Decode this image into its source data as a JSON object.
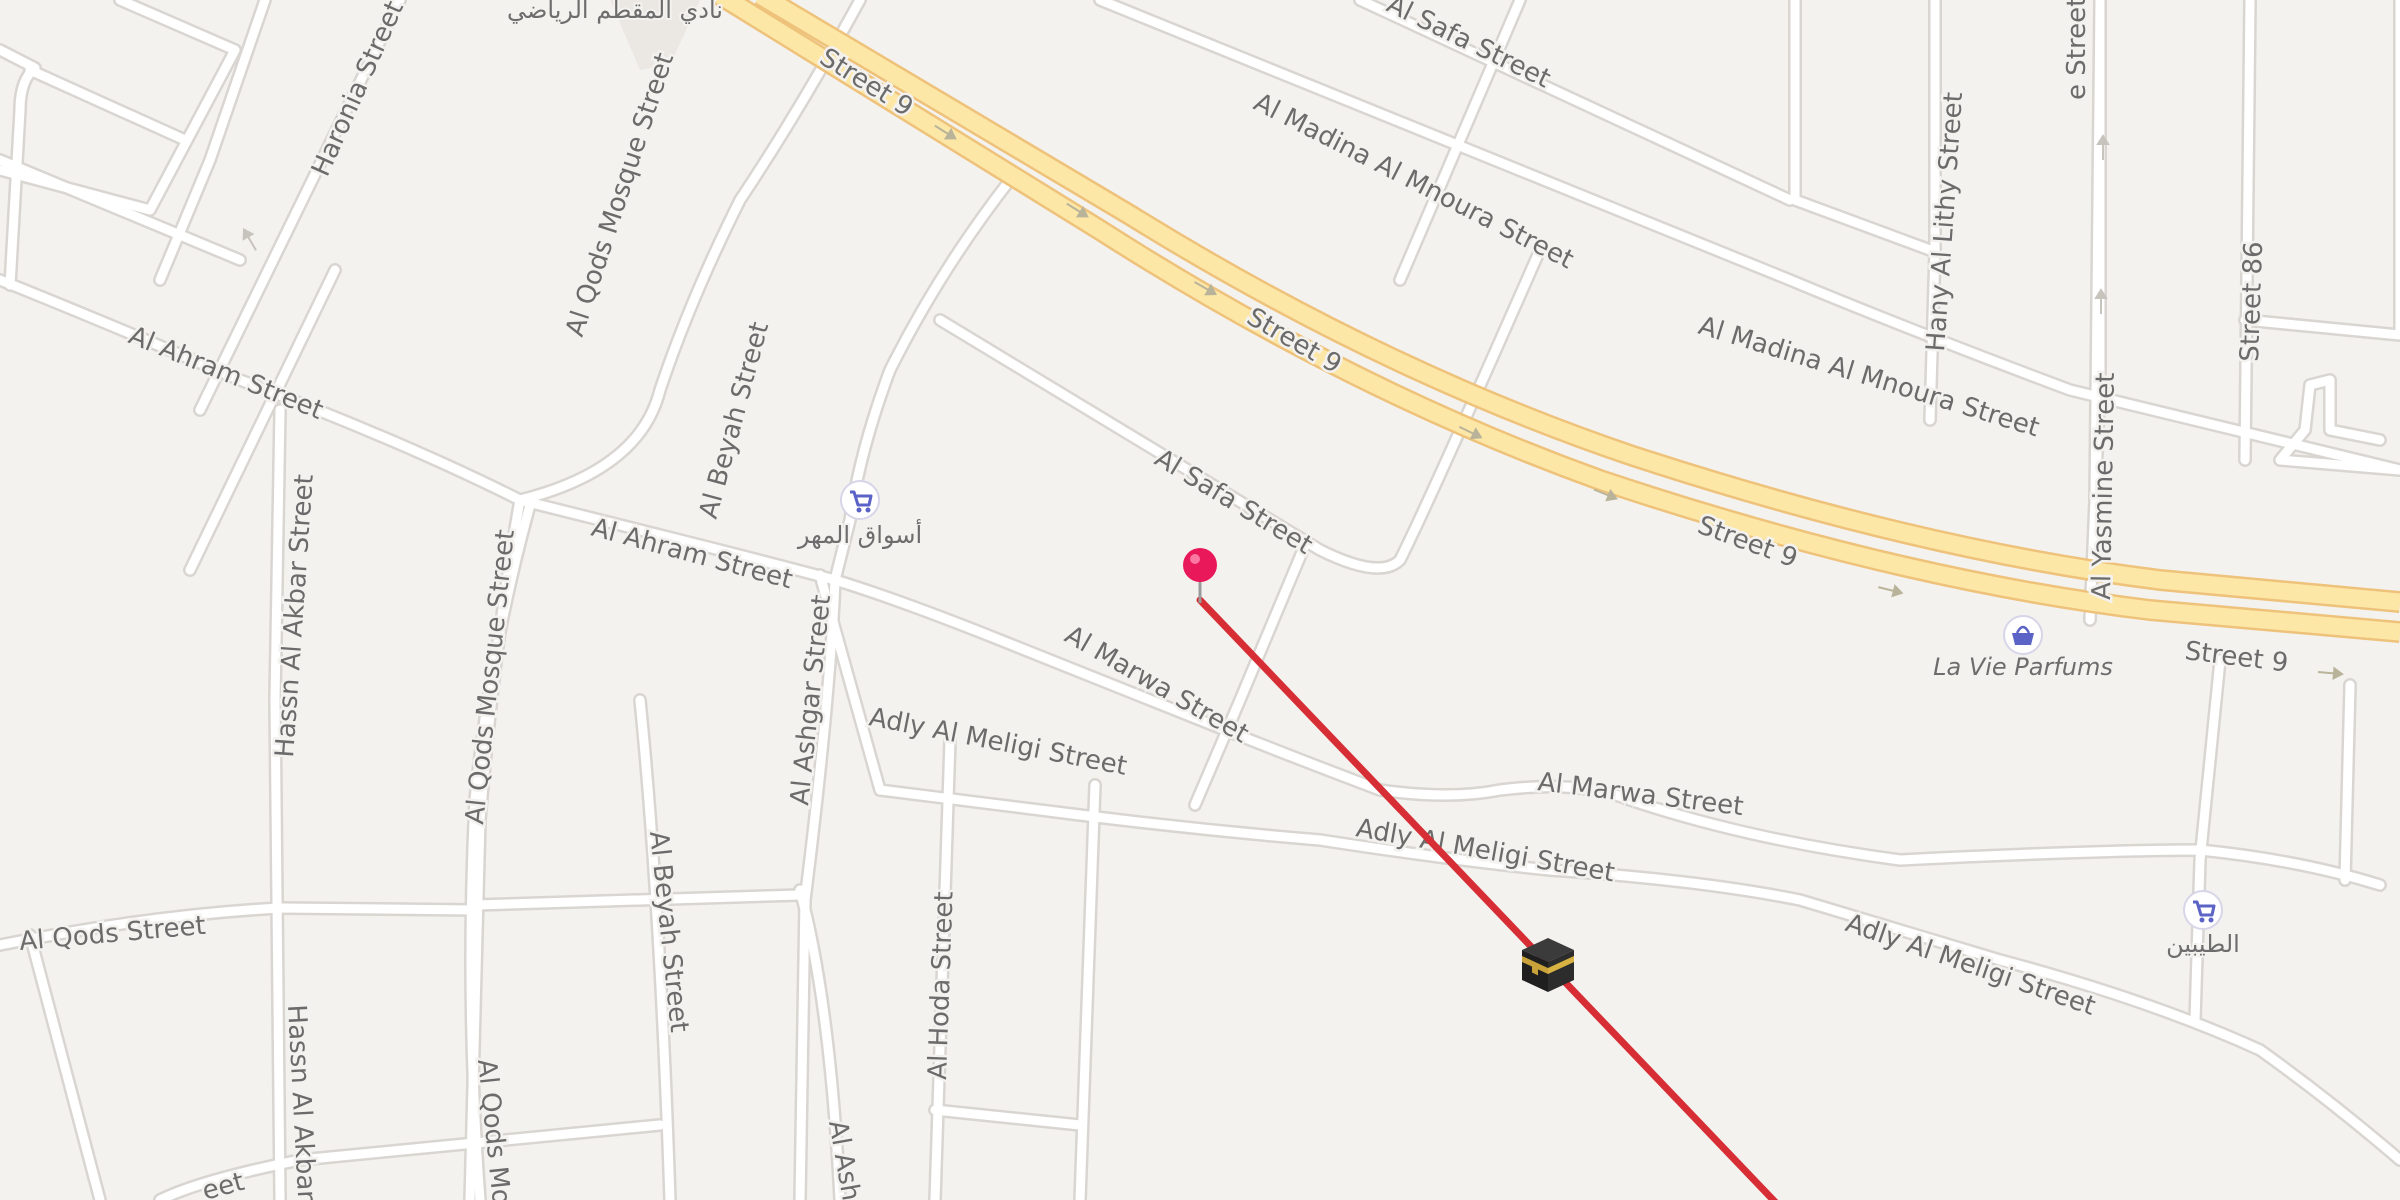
{
  "map": {
    "streets": {
      "haronia": "Haronia Street",
      "al_qods_mosque_1": "Al Qods Mosque Street",
      "al_qods_mosque_2": "Al Qods Mosque Street",
      "al_qods_mosque_3": "Al Qods Mos",
      "street9_a": "Street 9",
      "street9_b": "Street 9",
      "street9_c": "Street 9",
      "street9_d": "Street 9",
      "al_safa_1": "Al Safa Street",
      "al_safa_2": "Al Safa Street",
      "madina_1": "Al Madina Al Mnoura Street",
      "madina_2": "Al Madina Al Mnoura Street",
      "hany_lithy": "Hany Al Lithy Street",
      "yasmine_top": "e Street",
      "yasmine": "Al Yasmine Street",
      "street86": "Street 86",
      "al_ahram_1": "Al Ahram Street",
      "al_ahram_2": "Al Ahram Street",
      "al_beyah_1": "Al Beyah Street",
      "al_beyah_2": "Al Beyah Street",
      "hassn_1": "Hassn Al Akbar Street",
      "hassn_2": "Hassn Al Akbar S",
      "al_ashgar_1": "Al Ashgar Street",
      "al_ashgar_2": "Al Ash",
      "al_marwa_1": "Al Marwa Street",
      "al_marwa_2": "Al Marwa Street",
      "adly_1": "Adly Al Meligi Street",
      "adly_2": "Adly Al Meligi Street",
      "adly_3": "Adly Al Meligi Street",
      "al_qods": "Al Qods Street",
      "al_hoda": "Al Hoda Street",
      "bottom_left": "eet"
    },
    "pois": {
      "sports_club": "نادي المقطم الرياضي",
      "aswaq_almaher": "أسواق المهر",
      "la_vie_parfums": "La Vie Parfums",
      "al_tayibeen": "الطيبين"
    },
    "icons": {
      "location_pin": "location-pin-icon",
      "kaaba": "kaaba-icon",
      "shopping_cart": "shopping-cart-icon",
      "shopping_basket": "shopping-basket-icon",
      "oneway_arrow": "oneway-arrow-icon"
    },
    "colors": {
      "background": "#f4f2ef",
      "road": "#ffffff",
      "highway": "#fce7a6",
      "highway_edge": "#eec27a",
      "qibla_line": "#d62e34",
      "pin": "#e8185a",
      "poi_icon": "#5c63c7"
    }
  }
}
